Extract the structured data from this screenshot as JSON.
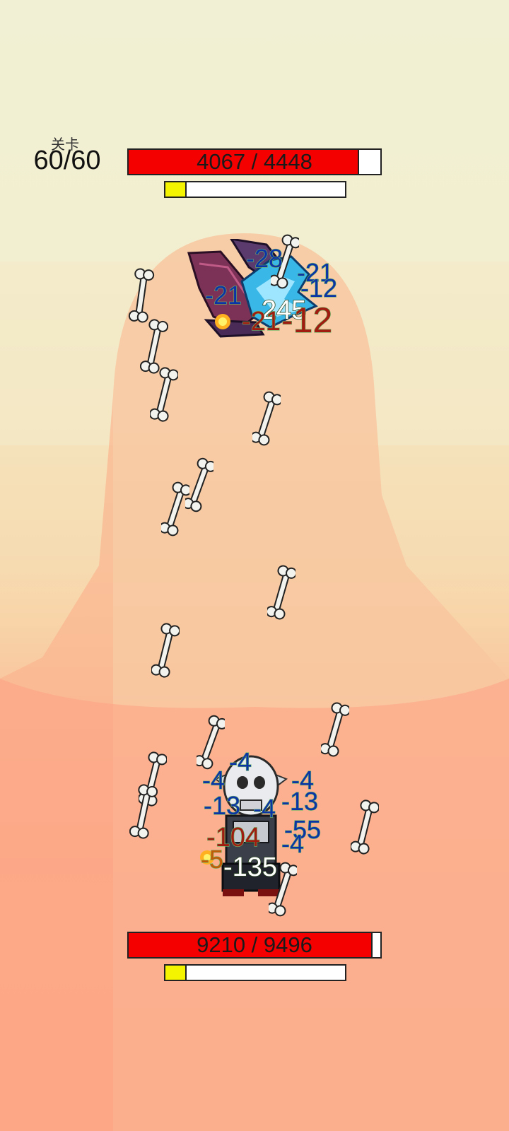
{
  "level": {
    "caption": "关卡",
    "value": "60/60"
  },
  "enemy": {
    "hp_current": 4067,
    "hp_max": 4448,
    "hp_text": "4067 / 4448",
    "energy_fraction": 0.12
  },
  "player": {
    "hp_current": 9210,
    "hp_max": 9496,
    "hp_text": "9210 / 9496",
    "energy_fraction": 0.12
  },
  "colors": {
    "hp_fill": "#f40000",
    "energy_fill": "#f4f400",
    "sky": "#f2f0d4",
    "ground": "#fe9878",
    "path": "#f8c9a2"
  },
  "damage_texts": {
    "enemy": [
      "-28",
      "-21",
      "-21",
      "-12",
      "245",
      "-21",
      "-12"
    ],
    "player": [
      "-4",
      "-4",
      "-4",
      "-13",
      "-4",
      "-13",
      "-104",
      "-55",
      "-4",
      "-5",
      "-135"
    ]
  },
  "sprites": {
    "enemy": "dragon-bat-sprite",
    "player": "skeleton-warrior-sprite",
    "projectile": "bone-projectile-icon",
    "effect": "fire-spark-icon"
  }
}
